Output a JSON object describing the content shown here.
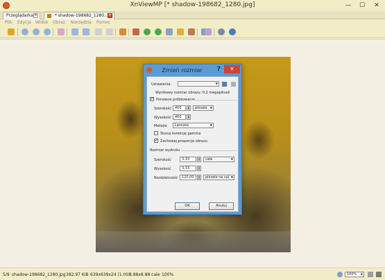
{
  "window": {
    "title": "XnViewMP [* shadow-198682_1280.jpg]",
    "minimize_glyph": "—",
    "maximize_glyph": "☐",
    "close_glyph": "✕"
  },
  "tabs": [
    {
      "label": "Przeglądarka"
    },
    {
      "label": "* shadow-198682_1280..."
    }
  ],
  "tab_close_glyph": "✕",
  "menu": [
    "Plik",
    "Edycja",
    "Widok",
    "Obraz",
    "Narzędzia",
    "Pomoc"
  ],
  "dialog": {
    "title": "Zmień rozmiar",
    "help_glyph": "?",
    "close_glyph": "✕",
    "settings_label": "Ustawienia:",
    "settings_value": "",
    "output_size_text": "Wynikowy rozmiar obrazu: 0.2 megapikseli",
    "resample_label": "Ponowne próbkowanie",
    "resample_checked": true,
    "width_label": "Szerokość",
    "width_value": "400",
    "unit_value": "piksele",
    "height_label": "Wysokość",
    "height_value": "400",
    "method_label": "Metoda",
    "method_value": "Lanczos",
    "gamma_label": "Stosuj korekcję gamma",
    "gamma_checked": false,
    "keep_ratio_label": "Zachowaj proporcje obrazu",
    "keep_ratio_checked": true,
    "print_section_label": "Rozmiar wydruku",
    "print_width_label": "Szerokość",
    "print_width_value": "3,33",
    "print_unit_value": "cale",
    "print_height_label": "Wysokość",
    "print_height_value": "3,33",
    "resolution_label": "Rozdzielczość",
    "resolution_value": "120,00",
    "resolution_unit": "piksele na cal",
    "ok_label": "OK",
    "cancel_label": "Anuluj",
    "check_glyph": "✔",
    "spin_up": "▲",
    "spin_down": "▼",
    "dropdown_arrow": "▼"
  },
  "status": {
    "position": "5/9",
    "filename": "shadow-198682_1280.jpg",
    "filesize": "382.97 KiB",
    "dimensions": "639x639x24 (1.00)",
    "print_size": "8.88x8.88 cale",
    "zoom_percent": "100%",
    "zoom_value": "100%",
    "zoom_arrow": "▼"
  },
  "colors": {
    "dialog_frame": "#5c9bd3",
    "close_button": "#c7463a",
    "app_accent": "#e0581f"
  }
}
